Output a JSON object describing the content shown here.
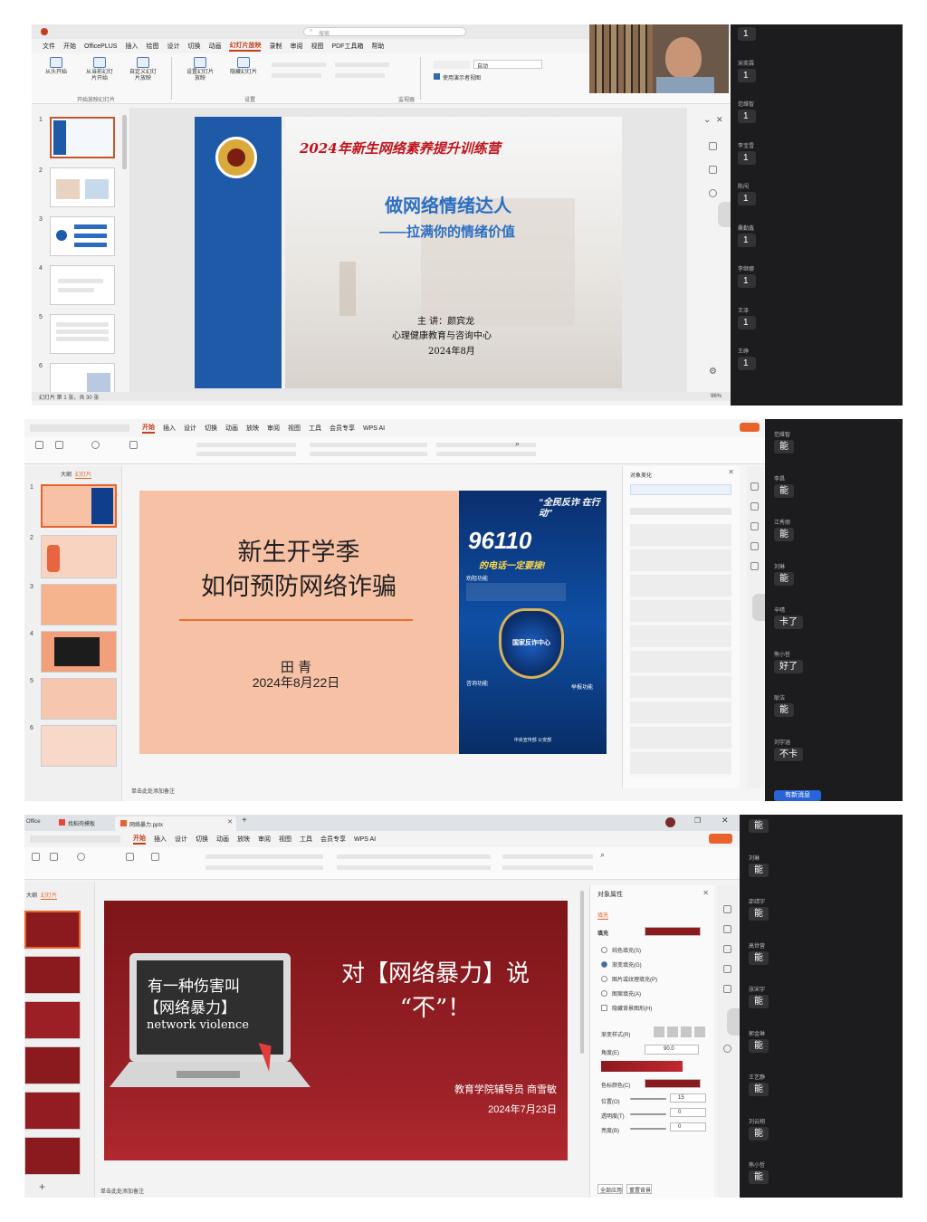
{
  "shot1": {
    "window_title": "",
    "search_placeholder": "搜索",
    "menu": [
      "文件",
      "开始",
      "OfficePLUS",
      "插入",
      "绘图",
      "设计",
      "切换",
      "动画",
      "幻灯片放映",
      "录制",
      "审阅",
      "视图",
      "PDF工具箱",
      "帮助"
    ],
    "active_menu": "幻灯片放映",
    "ribbon": {
      "btn_from_start": "从头开始",
      "btn_from_current": "从当前幻灯片开始",
      "btn_custom": "自定义幻灯片放映",
      "group_start": "开始放映幻灯片",
      "group_setup": "设置",
      "group_monitor": "监视器",
      "monitor_value": "自动",
      "presenter_view": "使用演示者视图",
      "btn_setup": "设置幻灯片放映",
      "btn_hide": "隐藏幻灯片"
    },
    "thumb_numbers": [
      "1",
      "2",
      "3",
      "4",
      "5",
      "6"
    ],
    "slide": {
      "header": "2024年新生网络素养提升训练营",
      "title": "做网络情绪达人",
      "subtitle": "——拉满你的情绪价值",
      "speaker": "主 讲：颜宾龙",
      "org": "心理健康教育与咨询中心",
      "date": "2024年8月"
    },
    "status": "幻灯片 第 1 张，共 30 张",
    "zoom": "96%",
    "chat": [
      {
        "name": "",
        "msg": "1"
      },
      {
        "name": "宋奕霖",
        "msg": "1"
      },
      {
        "name": "范维智",
        "msg": "1"
      },
      {
        "name": "李宝雪",
        "msg": "1"
      },
      {
        "name": "陈闯",
        "msg": "1"
      },
      {
        "name": "桑勤鑫",
        "msg": "1"
      },
      {
        "name": "李继娜",
        "msg": "1"
      },
      {
        "name": "王泽",
        "msg": "1"
      },
      {
        "name": "王峥",
        "msg": "1"
      }
    ]
  },
  "shot2": {
    "menu": [
      "开始",
      "插入",
      "设计",
      "切换",
      "动画",
      "放映",
      "审阅",
      "视图",
      "工具",
      "会员专享",
      "WPS AI"
    ],
    "active_menu": "开始",
    "panel_tabs": [
      "大纲",
      "幻灯片"
    ],
    "thumb_numbers": [
      "1",
      "2",
      "3",
      "4",
      "5",
      "6"
    ],
    "slide": {
      "title_line1": "新生开学季",
      "title_line2": "如何预防网络诈骗",
      "presenter": "田  青",
      "date": "2024年8月22日",
      "poster_slogan": "“全民反诈 在行动”",
      "poster_number": "96110",
      "poster_sub": "的电话一定要接!",
      "poster_badge": "国家反诈中心",
      "poster_f1": "劝阻功能",
      "poster_f2": "咨询功能",
      "poster_f3": "举报功能",
      "poster_footer": "中央宣传部  公安部"
    },
    "object_panel_title": "对象美化",
    "notes_placeholder": "单击此处添加备注",
    "chat": [
      {
        "name": "范维智",
        "msg": "能"
      },
      {
        "name": "李昌",
        "msg": "能"
      },
      {
        "name": "江秀丽",
        "msg": "能"
      },
      {
        "name": "刘琳",
        "msg": "能"
      },
      {
        "name": "辛晴",
        "msg": "卡了"
      },
      {
        "name": "熊小哲",
        "msg": "好了"
      },
      {
        "name": "耿洁",
        "msg": "能"
      },
      {
        "name": "刘宇涵",
        "msg": "不卡"
      }
    ],
    "new_msg_button": "有新消息"
  },
  "shot3": {
    "tabs": [
      "Office",
      "找稻壳模板",
      "网络暴力.pptx"
    ],
    "menu": [
      "开始",
      "插入",
      "设计",
      "切换",
      "动画",
      "放映",
      "审阅",
      "视图",
      "工具",
      "会员专享",
      "WPS AI"
    ],
    "active_menu": "开始",
    "panel_tabs": [
      "大纲",
      "幻灯片"
    ],
    "slide": {
      "screen_line1": "有一种伤害叫",
      "screen_line2": "【网络暴力】",
      "screen_line3": "network  violence",
      "headline1": "对【网络暴力】说",
      "headline2": "“不”！",
      "presenter": "教育学院辅导员  商雪敏",
      "date": "2024年7月23日"
    },
    "props_panel": {
      "title": "对象属性",
      "tab": "填充",
      "fill_label": "填充",
      "options": [
        "纯色填充(S)",
        "渐变填充(G)",
        "图片或纹理填充(P)",
        "图案填充(A)",
        "隐藏背景图形(H)"
      ],
      "selected_option": "渐变填充(G)",
      "style_label": "渐变样式(R)",
      "angle_label": "角度(E)",
      "angle_value": "90.0",
      "color_label": "色标颜色(C)",
      "position_label": "位置(O)",
      "position_value": "15",
      "transparency_label": "透明度(T)",
      "transparency_value": "0",
      "brightness_label": "亮度(B)",
      "brightness_value": "0",
      "apply_all": "全部应用",
      "reset": "重置背景",
      "fill_color": "#8b1a1f"
    },
    "notes_placeholder": "单击此处添加备注",
    "chat": [
      {
        "name": "",
        "msg": "能"
      },
      {
        "name": "刘琳",
        "msg": "能"
      },
      {
        "name": "邵靖宇",
        "msg": "能"
      },
      {
        "name": "高世营",
        "msg": "能"
      },
      {
        "name": "张宋宇",
        "msg": "能"
      },
      {
        "name": "郭金琳",
        "msg": "能"
      },
      {
        "name": "王艺静",
        "msg": "能"
      },
      {
        "name": "刘云翔",
        "msg": "能"
      },
      {
        "name": "熊小哲",
        "msg": "能"
      }
    ]
  },
  "colors": {
    "ppt_accent": "#c43e1c",
    "wps_accent": "#e8632b",
    "slide1_blue": "#1e5aa8",
    "slide1_red": "#c0141c",
    "slide2_peach": "#f7c1a6",
    "slide3_red": "#8b1a1f",
    "chat_bg": "#1c1c1e"
  }
}
